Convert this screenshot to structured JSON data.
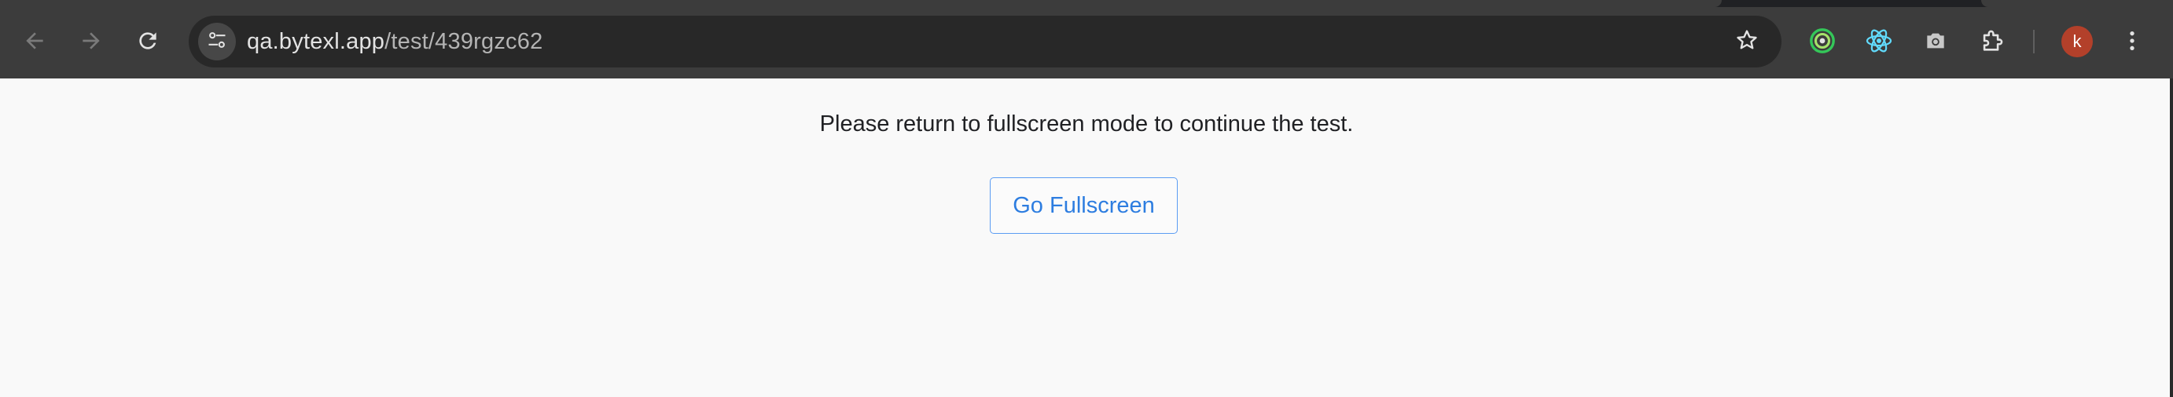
{
  "browser": {
    "url_host": "qa.bytexl.app",
    "url_path": "/test/439rgzc62",
    "nav_buttons": [
      {
        "name": "back-icon"
      },
      {
        "name": "forward-icon"
      },
      {
        "name": "reload-icon"
      }
    ],
    "extensions": [
      {
        "name": "green-ring-extension-icon",
        "color": "#34c759"
      },
      {
        "name": "react-devtools-icon",
        "color": "#61dafb"
      },
      {
        "name": "camera-extension-icon",
        "color": "#c8c8c8"
      },
      {
        "name": "puzzle-extensions-icon",
        "color": "#e3e3e3"
      }
    ],
    "profile_initial": "k",
    "profile_color": "#b3402a"
  },
  "page": {
    "message": "Please return to fullscreen mode to continue the test.",
    "button_label": "Go Fullscreen",
    "accent_color": "#2d7de0"
  }
}
